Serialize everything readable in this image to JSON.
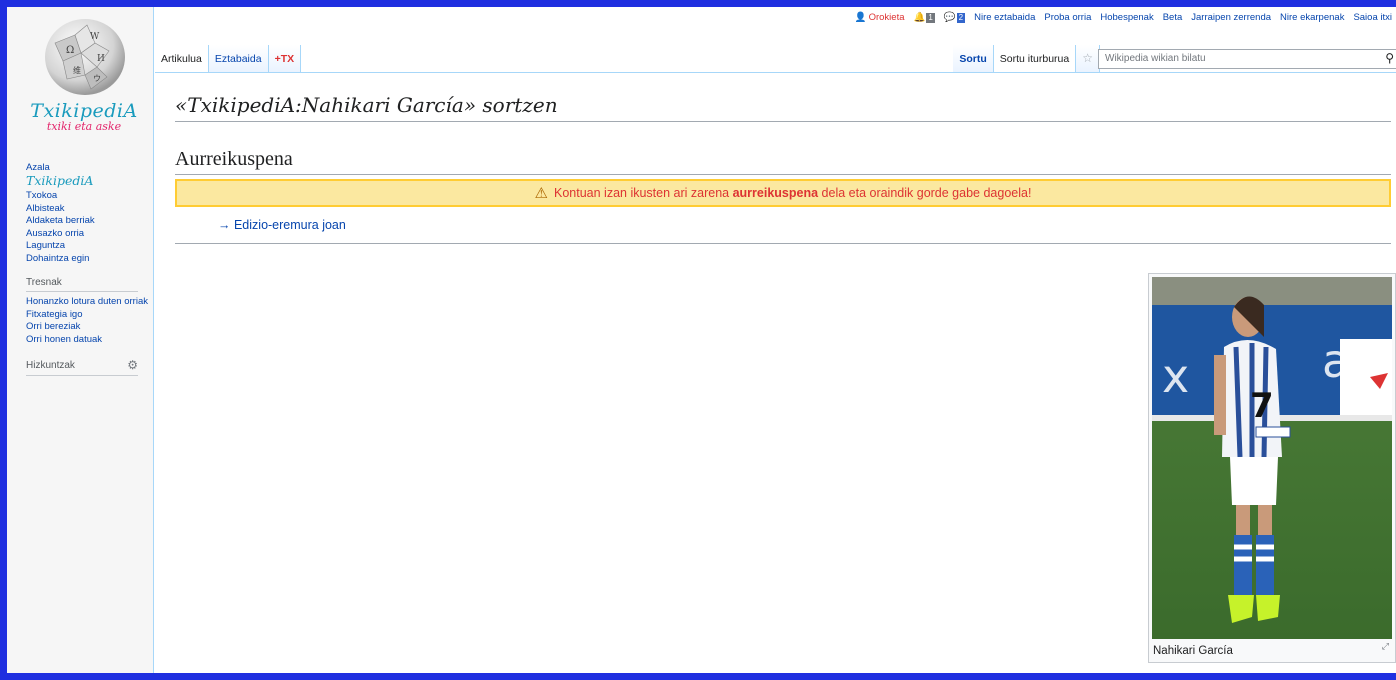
{
  "logo": {
    "wordmark_line1": "TxikipediA",
    "wordmark_line2": "txiki eta aske",
    "globe_icon": "wikipedia-puzzle-globe"
  },
  "sidebar": {
    "nav": {
      "azala_label": "Azala",
      "brand_label": "TxikipediA",
      "items": [
        "Txokoa",
        "Albisteak",
        "Aldaketa berriak",
        "Ausazko orria",
        "Laguntza",
        "Dohaintza egin"
      ]
    },
    "tools": {
      "heading": "Tresnak",
      "items": [
        "Honanzko lotura duten orriak",
        "Fitxategia igo",
        "Orri bereziak",
        "Orri honen datuak"
      ]
    },
    "languages": {
      "heading": "Hizkuntzak",
      "gear_icon": "gear-icon"
    }
  },
  "personal": {
    "username": "Orokieta",
    "alerts_count": "1",
    "notices_count": "2",
    "links": [
      "Nire eztabaida",
      "Proba orria",
      "Hobespenak",
      "Beta",
      "Jarraipen zerrenda",
      "Nire ekarpenak",
      "Saioa itxi"
    ]
  },
  "tabs": {
    "left": [
      {
        "label": "Artikulua",
        "selected": true
      },
      {
        "label": "Eztabaida",
        "selected": false
      },
      {
        "label": "+TX",
        "selected": false
      }
    ],
    "right": [
      {
        "label": "Sortu",
        "bold": true
      },
      {
        "label": "Sortu iturburua",
        "bold": false
      }
    ],
    "watch_icon": "star-icon"
  },
  "search": {
    "placeholder": "Wikipedia wikian bilatu"
  },
  "content": {
    "title": "«TxikipediA:Nahikari García» sortzen",
    "preview_heading": "Aurreikuspena",
    "warning_before": "Kontuan izan ikusten ari zarena ",
    "warning_bold": "aurreikuspena",
    "warning_after": " dela eta oraindik gorde gabe dagoela!",
    "edit_link": "→ Edizio-eremura joan",
    "image_caption": "Nahikari García"
  },
  "colors": {
    "frame": "#1f2fe0",
    "link": "#0645ad",
    "warning_bg": "#fbe8a0",
    "warning_text": "#dd3333"
  }
}
